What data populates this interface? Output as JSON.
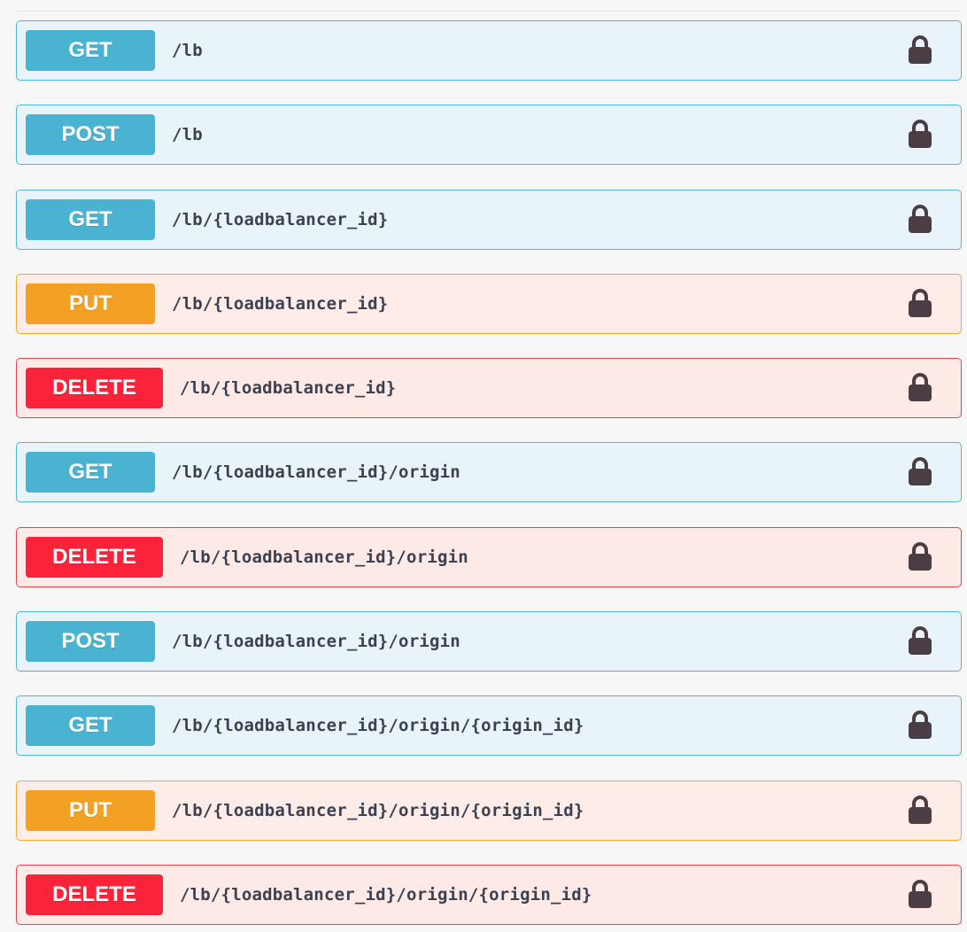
{
  "operations": [
    {
      "method": "GET",
      "kind": "get",
      "path": "/lb",
      "lock_icon": "lock-icon"
    },
    {
      "method": "POST",
      "kind": "post",
      "path": "/lb",
      "lock_icon": "lock-icon"
    },
    {
      "method": "GET",
      "kind": "get",
      "path": "/lb/{loadbalancer_id}",
      "lock_icon": "lock-icon"
    },
    {
      "method": "PUT",
      "kind": "put",
      "path": "/lb/{loadbalancer_id}",
      "lock_icon": "lock-icon"
    },
    {
      "method": "DELETE",
      "kind": "delete",
      "path": "/lb/{loadbalancer_id}",
      "lock_icon": "lock-icon"
    },
    {
      "method": "GET",
      "kind": "get",
      "path": "/lb/{loadbalancer_id}/origin",
      "lock_icon": "lock-icon"
    },
    {
      "method": "DELETE",
      "kind": "delete",
      "path": "/lb/{loadbalancer_id}/origin",
      "lock_icon": "lock-icon"
    },
    {
      "method": "POST",
      "kind": "post",
      "path": "/lb/{loadbalancer_id}/origin",
      "lock_icon": "lock-icon"
    },
    {
      "method": "GET",
      "kind": "get",
      "path": "/lb/{loadbalancer_id}/origin/{origin_id}",
      "lock_icon": "lock-icon"
    },
    {
      "method": "PUT",
      "kind": "put",
      "path": "/lb/{loadbalancer_id}/origin/{origin_id}",
      "lock_icon": "lock-icon"
    },
    {
      "method": "DELETE",
      "kind": "delete",
      "path": "/lb/{loadbalancer_id}/origin/{origin_id}",
      "lock_icon": "lock-icon"
    }
  ],
  "colors": {
    "get": "#4ab3d1",
    "post": "#4ab3d1",
    "put": "#f2a124",
    "delete": "#fa2339",
    "lock": "#4a3d44",
    "path_text": "#3b4151"
  }
}
